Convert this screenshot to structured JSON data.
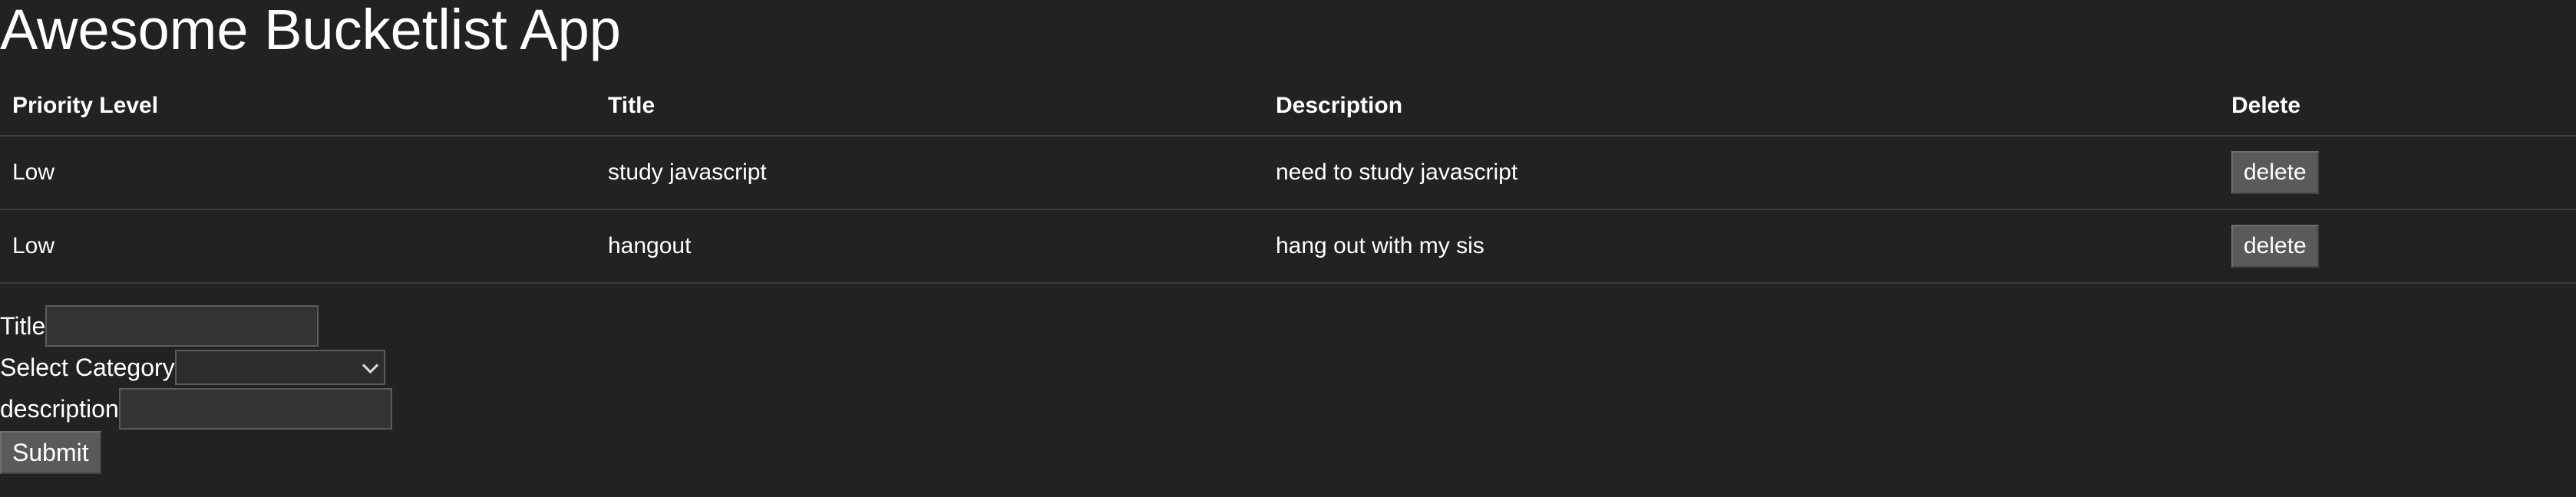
{
  "app": {
    "title": "Awesome Bucketlist App"
  },
  "table": {
    "headers": [
      "Priority Level",
      "Title",
      "Description",
      "Delete"
    ],
    "rows": [
      {
        "priority": "Low",
        "title": "study javascript",
        "description": "need to study javascript",
        "delete_label": "delete"
      },
      {
        "priority": "Low",
        "title": "hangout",
        "description": "hang out with my sis",
        "delete_label": "delete"
      }
    ]
  },
  "form": {
    "title_label": "Title",
    "title_value": "",
    "category_label": "Select Category",
    "category_value": "",
    "description_label": "description",
    "description_value": "",
    "submit_label": "Submit"
  },
  "colors": {
    "background": "#222222",
    "text": "#ffffff",
    "button": "#5a5a5a"
  },
  "icons": {
    "select_chevron": "chevron-down-icon"
  }
}
